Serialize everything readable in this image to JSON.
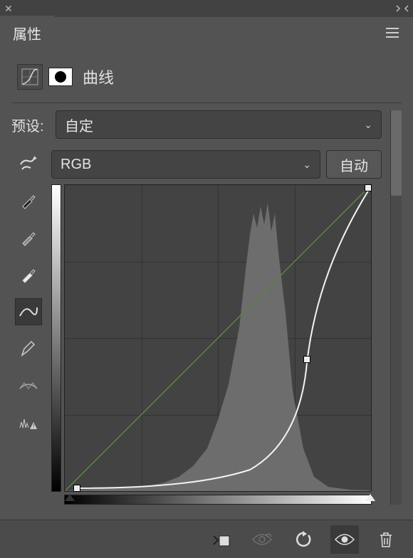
{
  "panel": {
    "tab_title": "属性",
    "adjustment_name": "曲线"
  },
  "preset": {
    "label": "预设:",
    "value": "自定"
  },
  "channel": {
    "value": "RGB",
    "auto_label": "自动"
  },
  "tools": {
    "targeted_adjust": "targeted-adjust",
    "black_eyedropper": "black-point-eyedropper",
    "gray_eyedropper": "gray-point-eyedropper",
    "white_eyedropper": "white-point-eyedropper",
    "curve_edit": "curve-point-edit",
    "draw_curve": "draw-curve",
    "smooth_curve": "smooth-curve",
    "clip_warn": "clipping-warning"
  },
  "bottom": {
    "clip_to_layer": "clip-to-layer",
    "view_prev": "view-previous-state",
    "reset": "reset",
    "visibility": "toggle-visibility",
    "delete": "delete-adjustment"
  }
}
